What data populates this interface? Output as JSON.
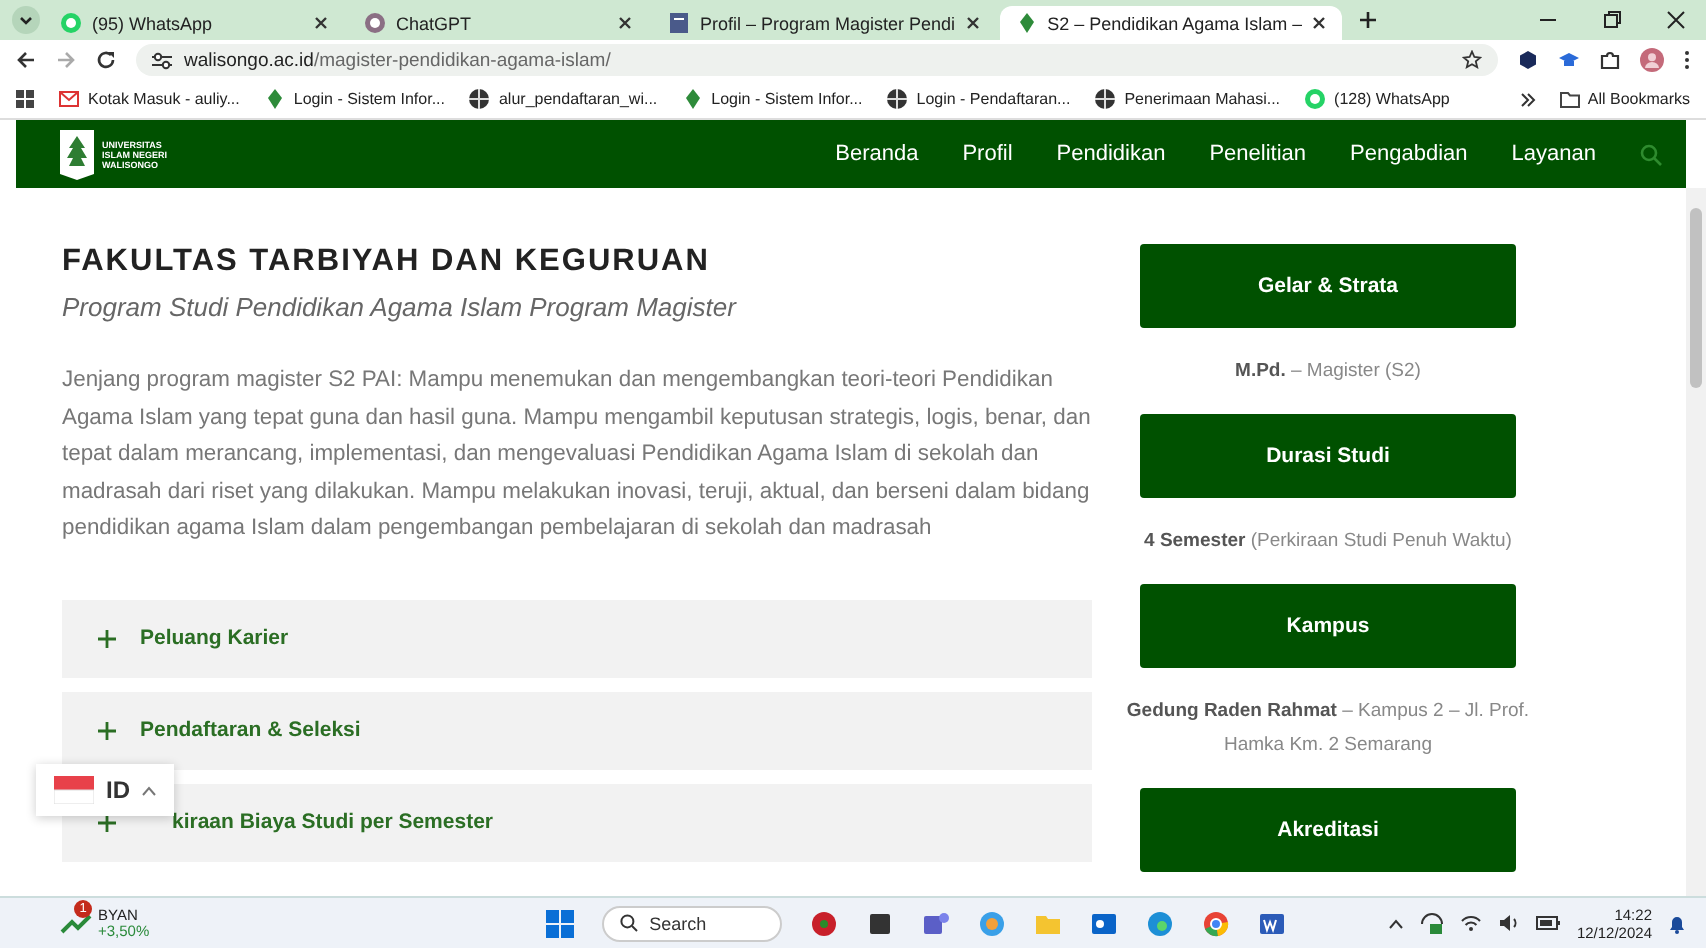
{
  "browser": {
    "tabs": [
      {
        "title": "(95) WhatsApp",
        "kind": "whatsapp",
        "selected": false
      },
      {
        "title": "ChatGPT",
        "kind": "chatgpt",
        "selected": false
      },
      {
        "title": "Profil – Program Magister Pendi",
        "kind": "page",
        "selected": false
      },
      {
        "title": "S2 – Pendidikan Agama Islam –",
        "kind": "site",
        "selected": true
      }
    ],
    "url": {
      "host": "walisongo.ac.id",
      "path": "/magister-pendidikan-agama-islam/"
    },
    "bookmarks": [
      {
        "label": "Kotak Masuk - auliy...",
        "kind": "mail"
      },
      {
        "label": "Login - Sistem Infor...",
        "kind": "site"
      },
      {
        "label": "alur_pendaftaran_wi...",
        "kind": "globe"
      },
      {
        "label": "Login - Sistem Infor...",
        "kind": "site"
      },
      {
        "label": "Login - Pendaftaran...",
        "kind": "globe"
      },
      {
        "label": "Penerimaan Mahasi...",
        "kind": "globe"
      },
      {
        "label": "(128) WhatsApp",
        "kind": "whatsapp"
      }
    ],
    "all_bookmarks": "All Bookmarks"
  },
  "site": {
    "logo_lines": [
      "UNIVERSITAS",
      "ISLAM NEGERI",
      "WALISONGO"
    ],
    "nav": [
      "Beranda",
      "Profil",
      "Pendidikan",
      "Penelitian",
      "Pengabdian",
      "Layanan"
    ]
  },
  "main": {
    "heading": "FAKULTAS TARBIYAH DAN KEGURUAN",
    "subheading": "Program Studi Pendidikan Agama Islam Program Magister",
    "description": "Jenjang program magister S2 PAI: Mampu menemukan dan mengembangkan teori-teori Pendidikan Agama Islam yang tepat guna dan hasil guna. Mampu mengambil keputusan strategis, logis, benar, dan tepat dalam merancang, implementasi, dan mengevaluasi Pendidikan Agama Islam di sekolah dan madrasah dari riset yang dilakukan. Mampu melakukan inovasi, teruji, aktual, dan berseni dalam bidang pendidikan agama Islam dalam pengembangan pembelajaran di sekolah dan madrasah",
    "accordion": [
      {
        "label": "Peluang Karier",
        "expanded": false,
        "partly_hidden": false
      },
      {
        "label": "Pendaftaran & Seleksi",
        "expanded": false,
        "partly_hidden": false
      },
      {
        "label": "kiraan Biaya Studi per Semester",
        "expanded": false,
        "partly_hidden": true
      }
    ]
  },
  "sidebar": [
    {
      "title": "Gelar & Strata",
      "detail": "**M.Pd.** – Magister (S2)"
    },
    {
      "title": "Durasi Studi",
      "detail": "**4 Semester** (Perkiraan Studi Penuh Waktu)"
    },
    {
      "title": "Kampus",
      "detail": "**Gedung Raden Rahmat** – Kampus 2 – Jl. Prof. Hamka Km. 2 Semarang"
    },
    {
      "title": "Akreditasi"
    }
  ],
  "language": {
    "code": "ID"
  },
  "taskbar": {
    "stock": {
      "name": "BYAN",
      "change": "+3,50%",
      "badge": "1"
    },
    "search": {
      "placeholder": "Search"
    },
    "time": "14:22",
    "date": "12/12/2024"
  }
}
